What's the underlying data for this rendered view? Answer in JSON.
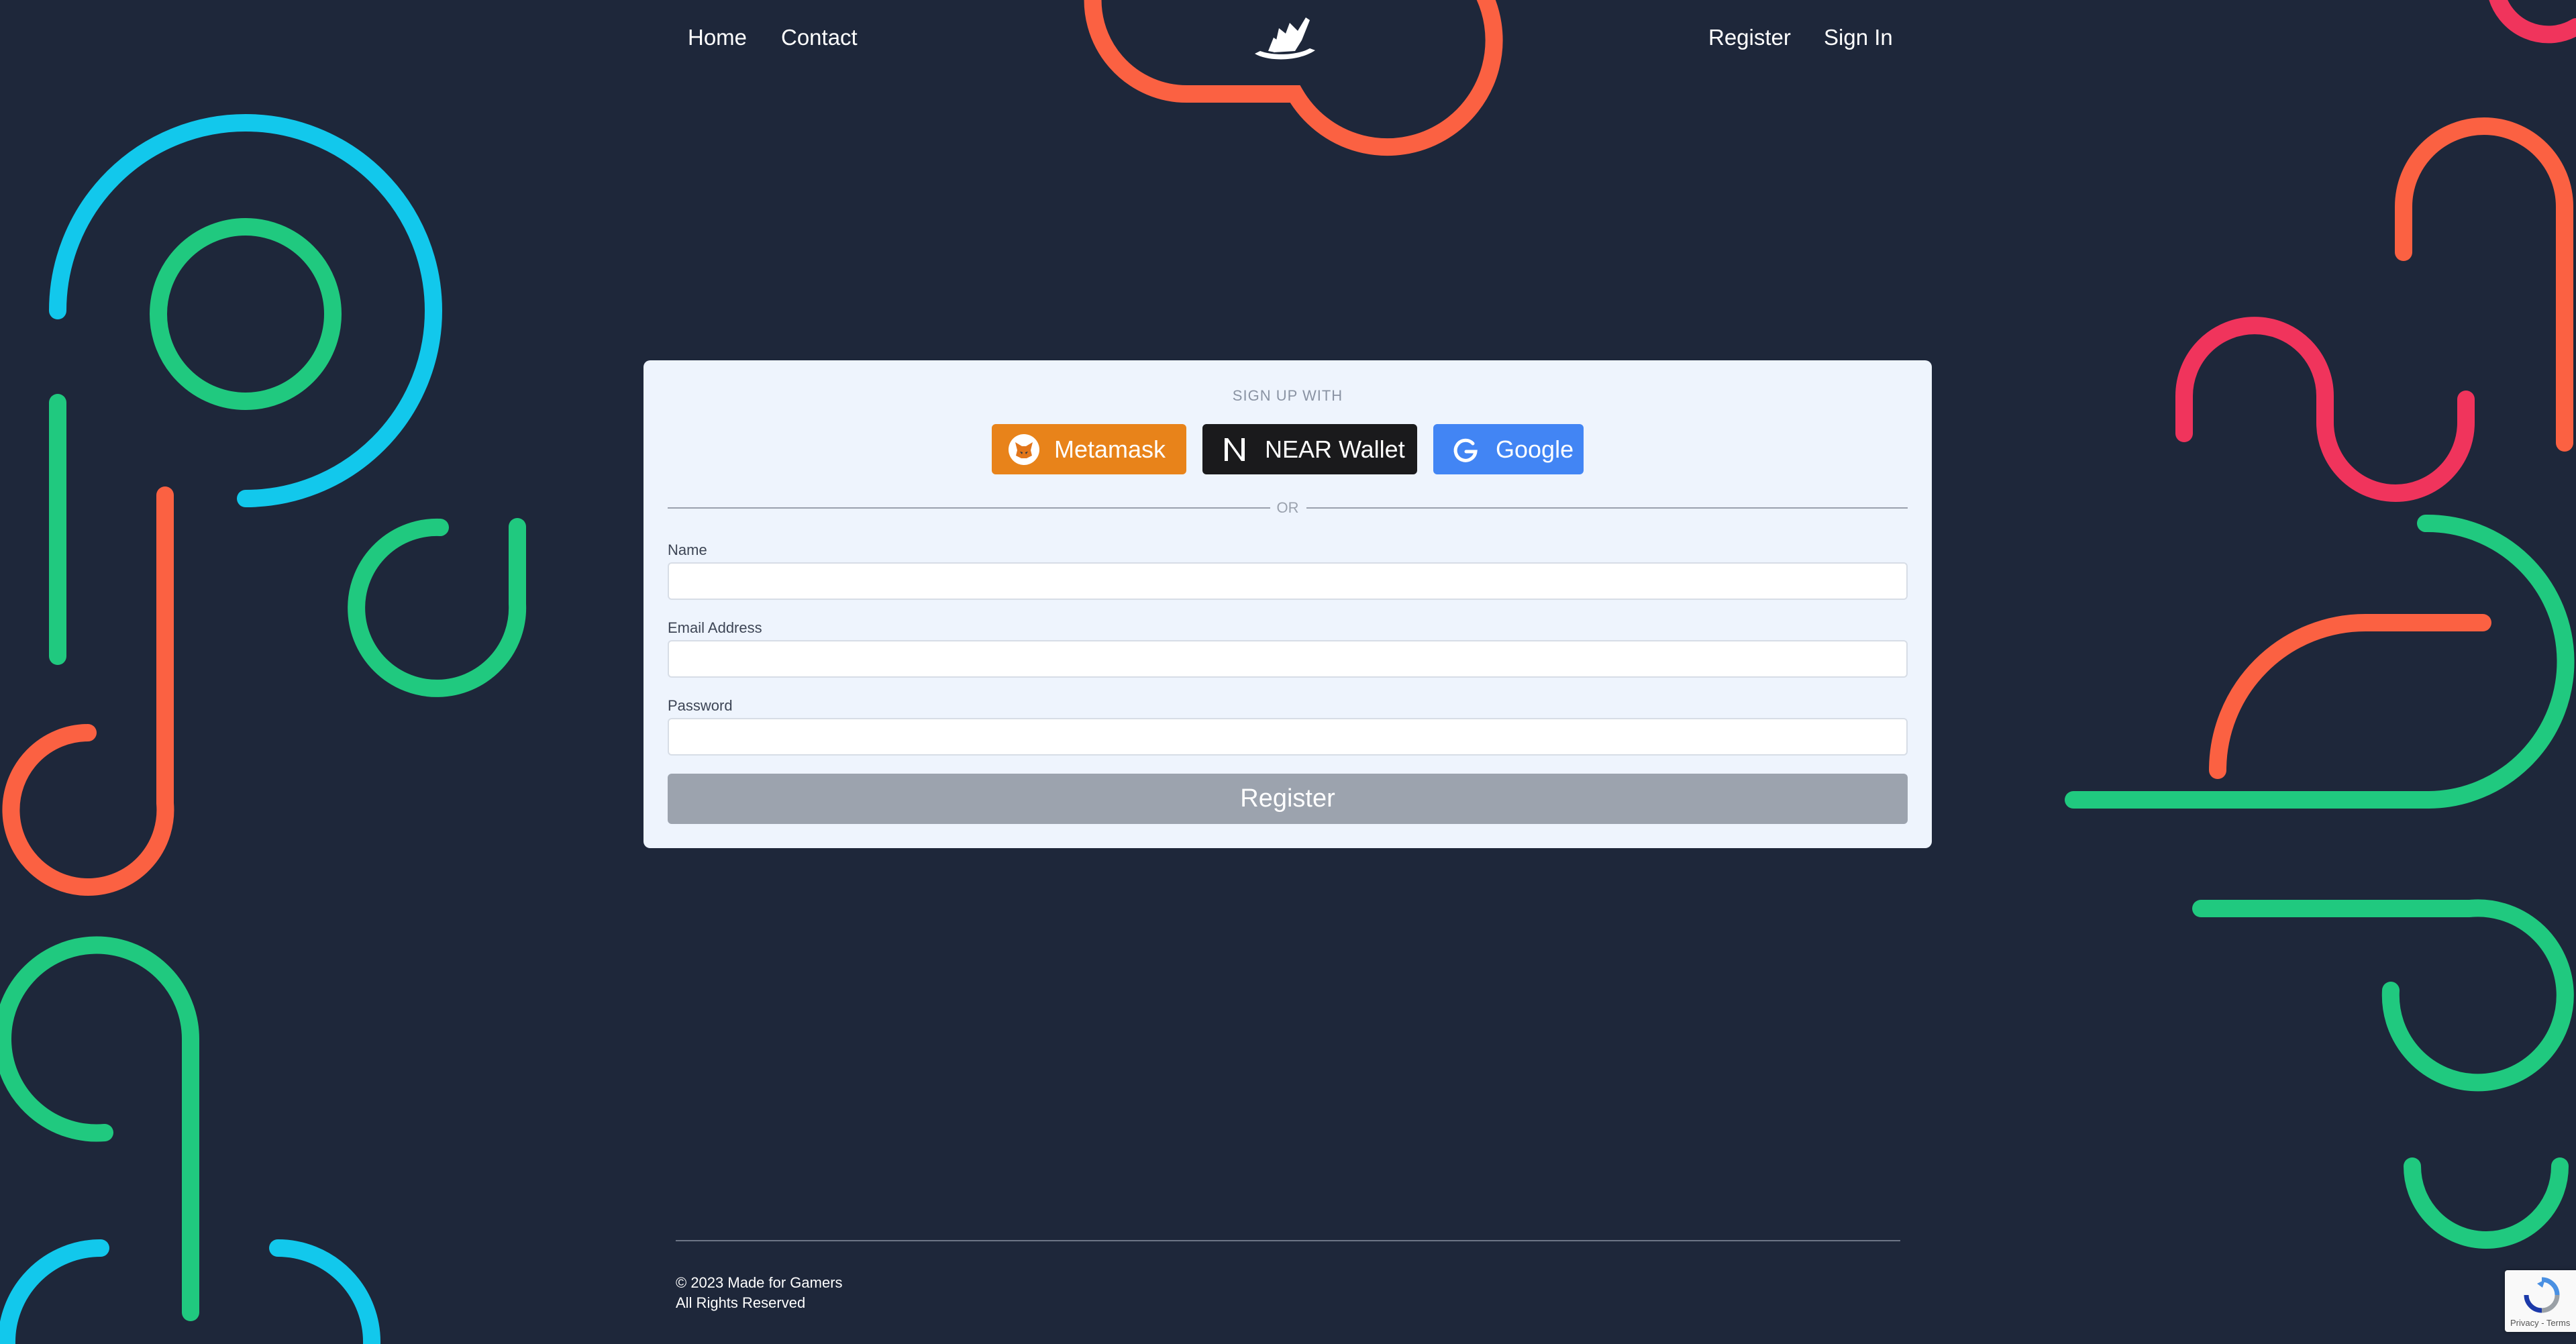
{
  "nav": {
    "home_label": "Home",
    "contact_label": "Contact",
    "register_label": "Register",
    "signin_label": "Sign In"
  },
  "signup": {
    "title": "SIGN UP WITH",
    "providers": [
      {
        "label": "Metamask",
        "icon": "metamask-fox-icon",
        "color": "#e8831a"
      },
      {
        "label": "NEAR Wallet",
        "icon": "near-logo-icon",
        "color": "#1a1a1c"
      },
      {
        "label": "Google",
        "icon": "google-g-icon",
        "color": "#4285f4"
      }
    ],
    "divider_text": "OR"
  },
  "form": {
    "name_label": "Name",
    "name_value": "",
    "email_label": "Email Address",
    "email_value": "",
    "password_label": "Password",
    "password_value": "",
    "submit_label": "Register"
  },
  "footer": {
    "copyright": "© 2023 Made for Gamers",
    "rights": "All Rights Reserved"
  },
  "recaptcha": {
    "terms_text": "Privacy - Terms"
  },
  "theme": {
    "background": "#1e273a",
    "card": "#eef4fd",
    "accent_orange": "#fb6142",
    "accent_cyan": "#12c8ec",
    "accent_green": "#20c97f",
    "accent_pink": "#f0345c"
  }
}
